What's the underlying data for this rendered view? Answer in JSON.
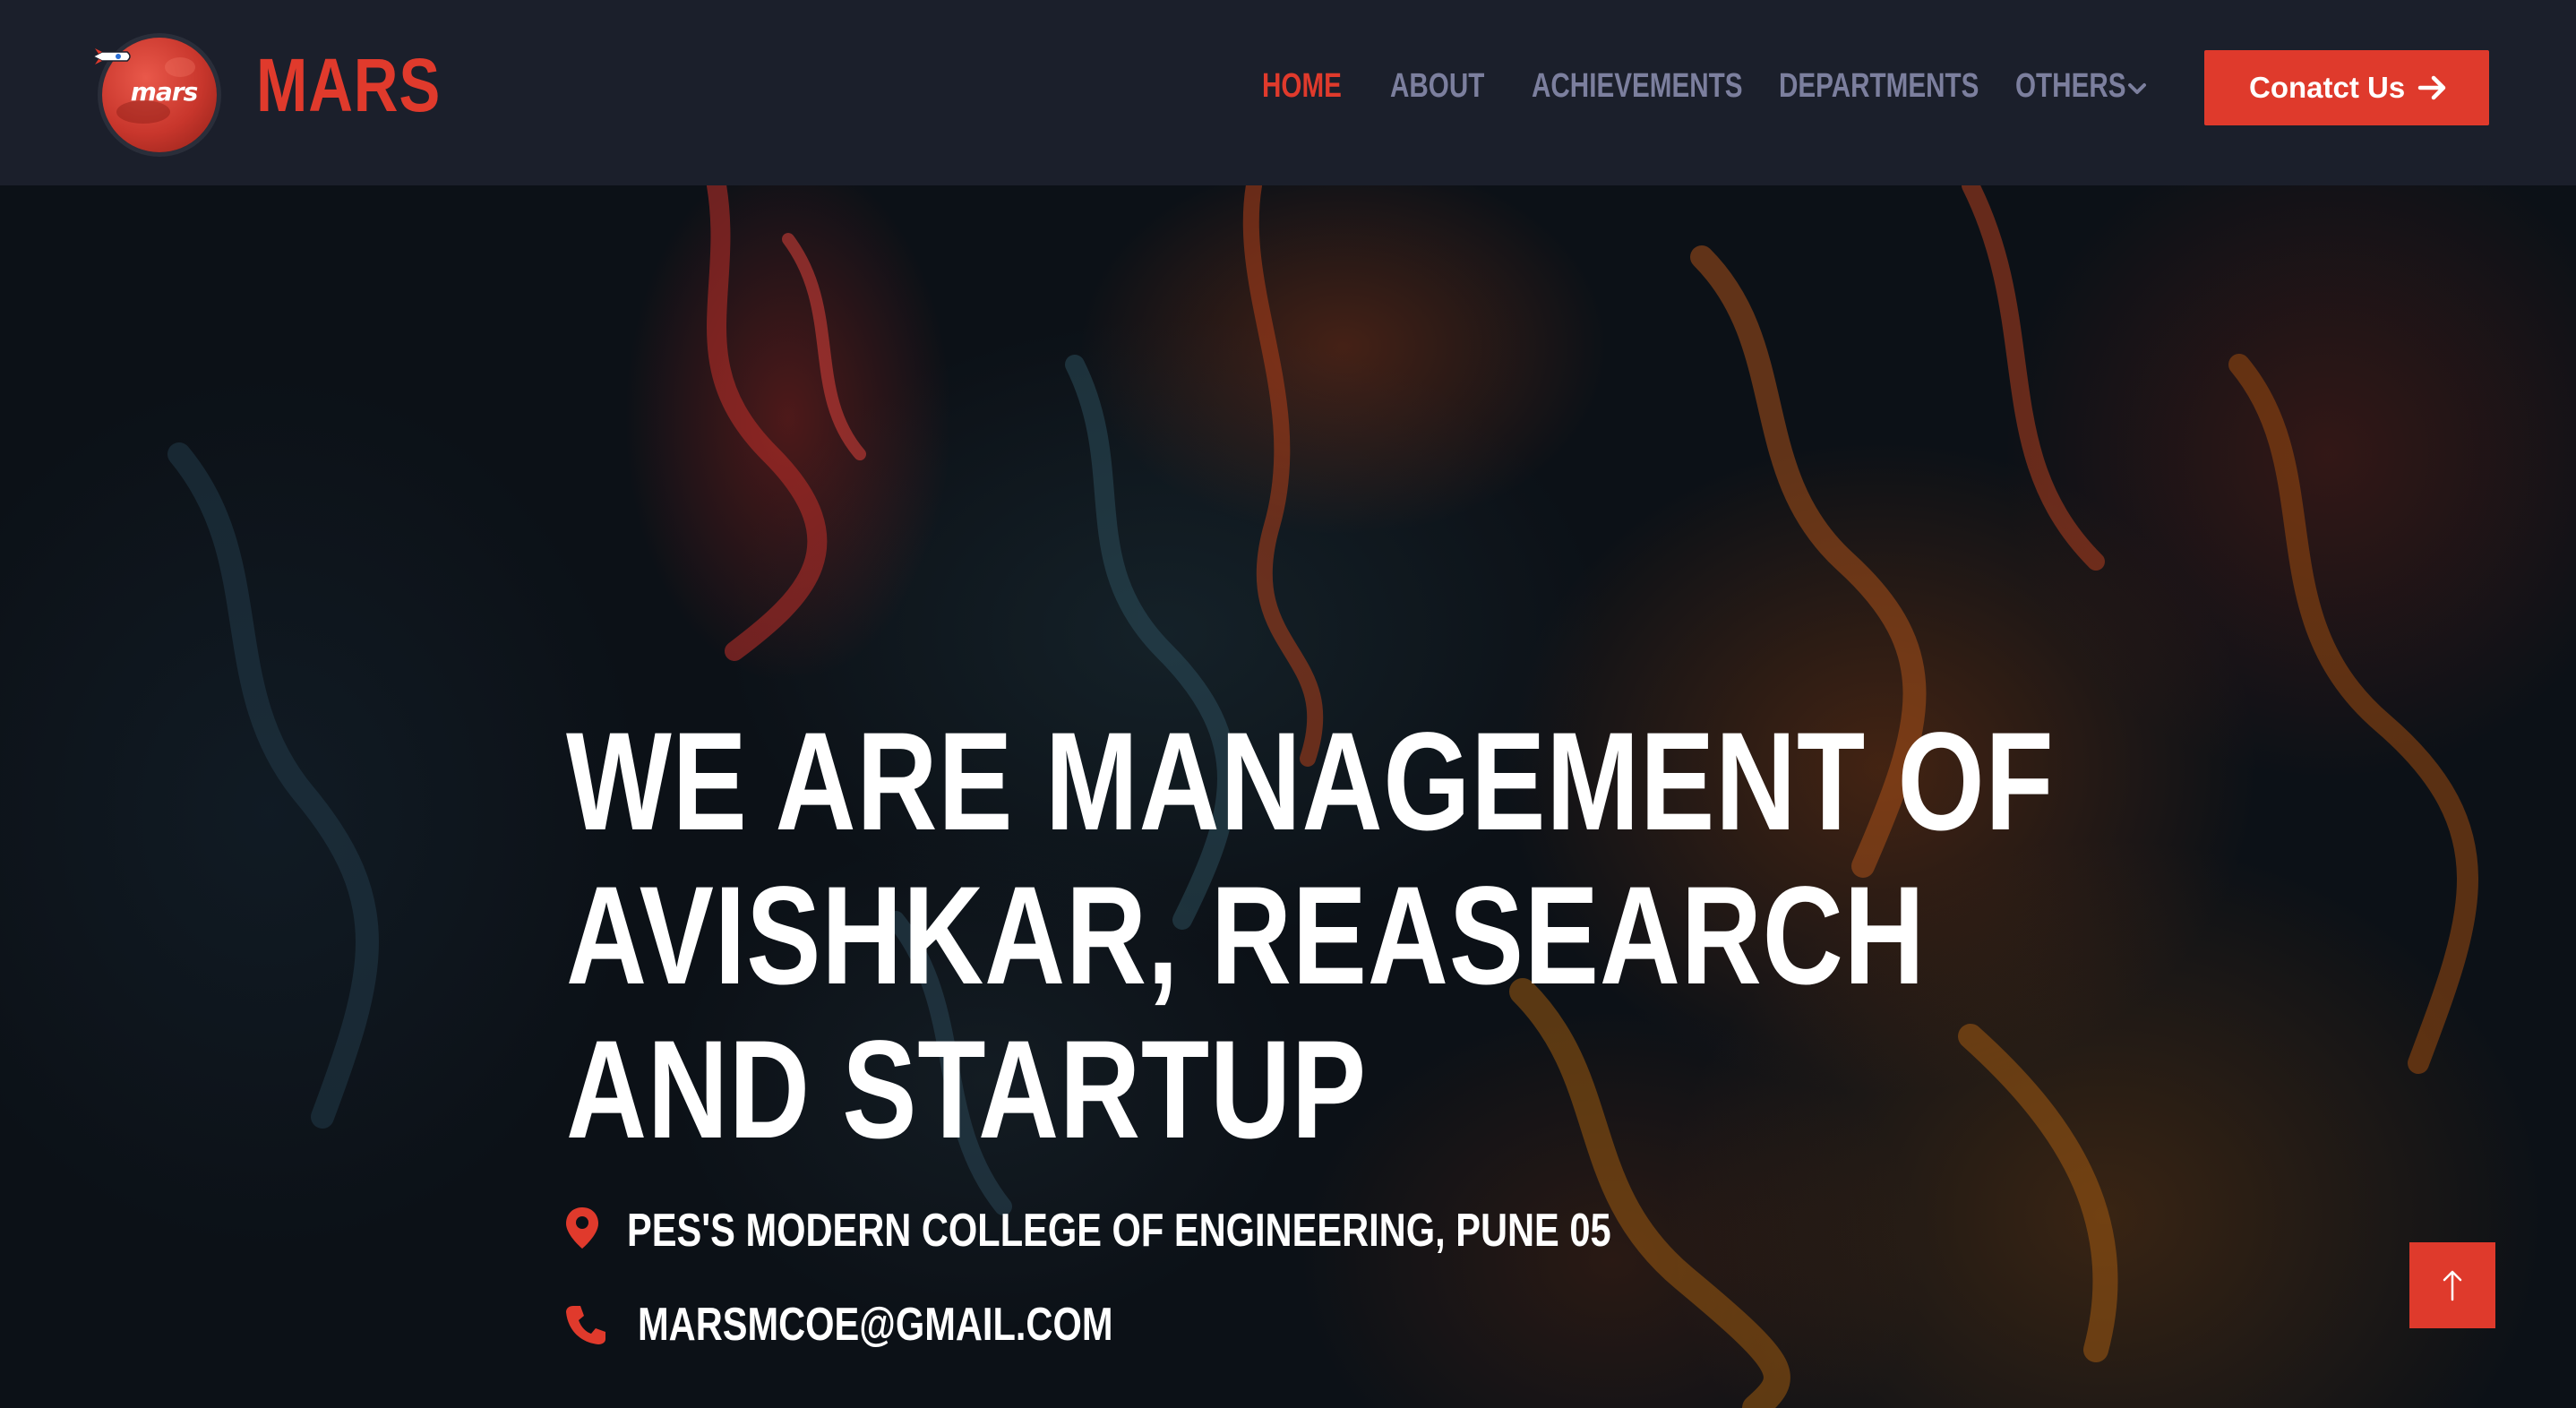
{
  "brand": {
    "logo_text": "mars",
    "name": "MARS"
  },
  "nav": {
    "items": [
      {
        "label": "HOME",
        "active": true
      },
      {
        "label": "ABOUT",
        "active": false
      },
      {
        "label": "ACHIEVEMENTS",
        "active": false
      },
      {
        "label": "DEPARTMENTS",
        "active": false
      },
      {
        "label": "OTHERS",
        "active": false,
        "has_dropdown": true
      }
    ],
    "cta_label": "Conatct Us"
  },
  "hero": {
    "headline": [
      "WE ARE MANAGEMENT OF",
      "AVISHKAR, REASEARCH",
      "AND STARTUP"
    ],
    "address": "PES'S MODERN COLLEGE OF ENGINEERING, PUNE 05",
    "email": "MARSMCOE@GMAIL.COM"
  },
  "icons": {
    "location": "map-pin-icon",
    "phone": "phone-icon",
    "cta": "arrow-right-icon",
    "dropdown": "chevron-down-icon",
    "scroll_top": "arrow-up-icon"
  },
  "colors": {
    "accent": "#e03a2c",
    "navbar_bg": "#1b1f2b",
    "nav_text": "#7c7f9e",
    "hero_text": "#ffffff"
  }
}
